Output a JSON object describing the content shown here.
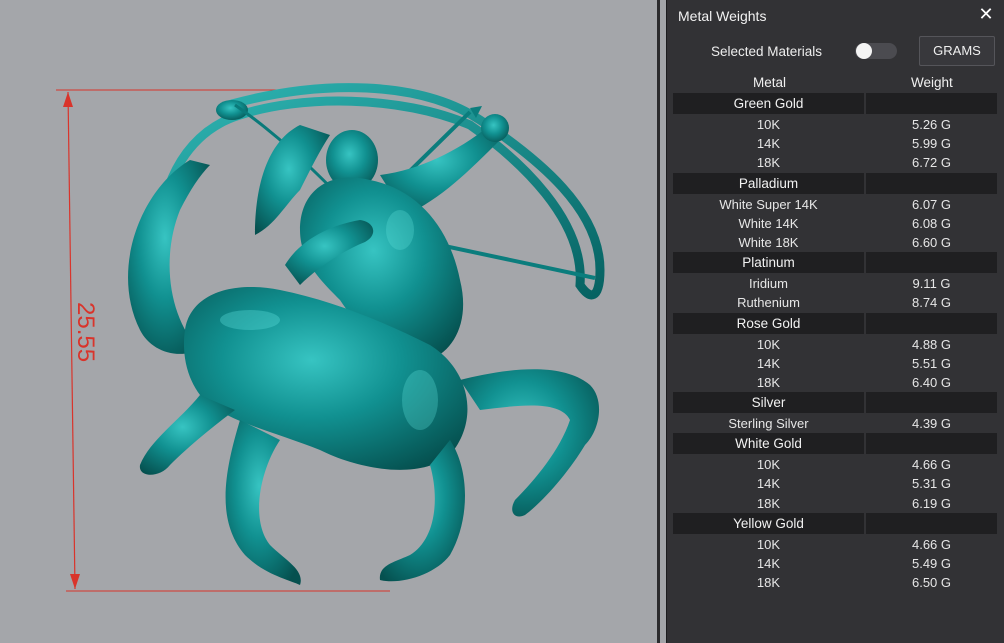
{
  "viewport": {
    "dimension_label": "25.55",
    "model": "centaur-archer-pendant",
    "model_color": "#0e8f8f",
    "dimension_color": "#d9342b"
  },
  "panel": {
    "title": "Metal Weights",
    "close_icon": "close-icon",
    "selected_label": "Selected Materials",
    "toggle_on": false,
    "unit_label": "GRAMS",
    "col_metal": "Metal",
    "col_weight": "Weight"
  },
  "groups": [
    {
      "name": "Green Gold",
      "rows": [
        {
          "metal": "10K",
          "weight": "5.26 G"
        },
        {
          "metal": "14K",
          "weight": "5.99 G"
        },
        {
          "metal": "18K",
          "weight": "6.72 G"
        }
      ]
    },
    {
      "name": "Palladium",
      "rows": [
        {
          "metal": "White Super 14K",
          "weight": "6.07 G"
        },
        {
          "metal": "White 14K",
          "weight": "6.08 G"
        },
        {
          "metal": "White 18K",
          "weight": "6.60 G"
        }
      ]
    },
    {
      "name": "Platinum",
      "rows": [
        {
          "metal": "Iridium",
          "weight": "9.11 G"
        },
        {
          "metal": "Ruthenium",
          "weight": "8.74 G"
        }
      ]
    },
    {
      "name": "Rose Gold",
      "rows": [
        {
          "metal": "10K",
          "weight": "4.88 G"
        },
        {
          "metal": "14K",
          "weight": "5.51 G"
        },
        {
          "metal": "18K",
          "weight": "6.40 G"
        }
      ]
    },
    {
      "name": "Silver",
      "rows": [
        {
          "metal": "Sterling Silver",
          "weight": "4.39 G"
        }
      ]
    },
    {
      "name": "White Gold",
      "rows": [
        {
          "metal": "10K",
          "weight": "4.66 G"
        },
        {
          "metal": "14K",
          "weight": "5.31 G"
        },
        {
          "metal": "18K",
          "weight": "6.19 G"
        }
      ]
    },
    {
      "name": "Yellow Gold",
      "rows": [
        {
          "metal": "10K",
          "weight": "4.66 G"
        },
        {
          "metal": "14K",
          "weight": "5.49 G"
        },
        {
          "metal": "18K",
          "weight": "6.50 G"
        }
      ]
    }
  ]
}
